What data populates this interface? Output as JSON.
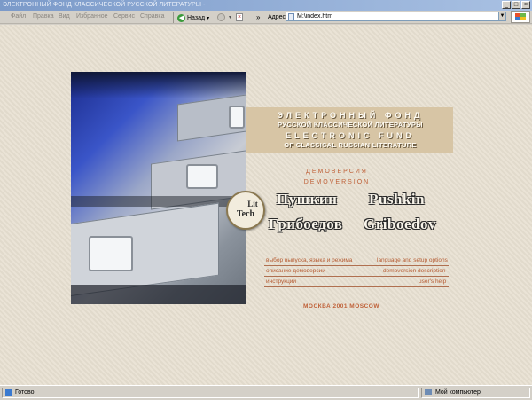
{
  "window": {
    "title": "ЭЛЕКТРОННЫЙ ФОНД КЛАССИЧЕСКОЙ РУССКОЙ ЛИТЕРАТУРЫ -",
    "min": "_",
    "max": "□",
    "close": "×"
  },
  "menu": [
    "Файл",
    "Правка",
    "Вид",
    "Избранное",
    "Сервис",
    "Справка"
  ],
  "toolbar": {
    "back_label": "Назад",
    "chevron": "»",
    "address_label": "Адрес",
    "address_value": "M:\\index.htm"
  },
  "colors": {
    "band": "#d7c5a5",
    "accent": "#c0623a",
    "background": "#e8e1d2"
  },
  "page": {
    "title_ru_1": "ЭЛЕКТРОННЫЙ ФОНД",
    "title_ru_2": "РУССКОЙ КЛАССИЧЕСКОЙ ЛИТЕРАТУРЫ",
    "title_en_1": "ELECTRONIC FUND",
    "title_en_2": "OF CLASSICAL RUSSIAN LITERATURE",
    "demo_ru": "ДЕМОВЕРСИЯ",
    "demo_en": "DEMOVERSION",
    "logo_top": "Lit",
    "logo_bottom": "Tech",
    "author1_ru": "Пушкин",
    "author1_en": "Pushkin",
    "author2_ru": "Грибоедов",
    "author2_en": "Griboedov",
    "links": [
      {
        "ru": "выбор выпуска, языка и режима",
        "en": "language and setup options"
      },
      {
        "ru": "описание демоверсии",
        "en": "demoversion description"
      },
      {
        "ru": "инструкции",
        "en": "user's help"
      }
    ],
    "footer": "МОСКВА 2001 MOSCOW"
  },
  "status": {
    "left": "Готово",
    "zone": "Мой компьютер"
  }
}
